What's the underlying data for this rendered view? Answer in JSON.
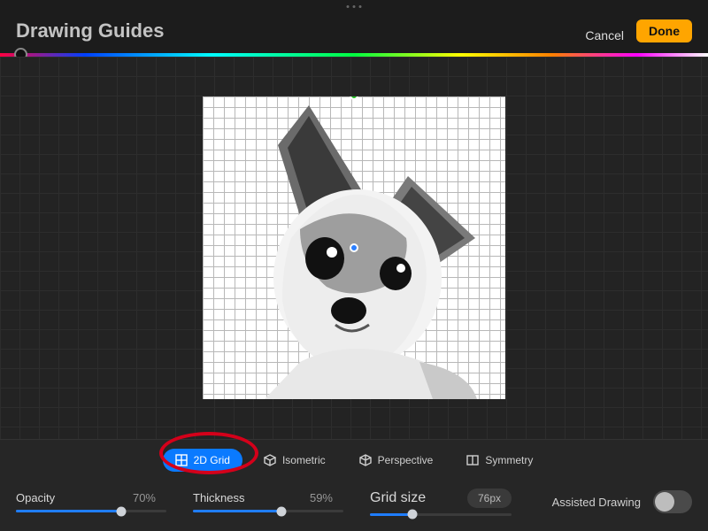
{
  "header": {
    "title": "Drawing Guides",
    "cancel": "Cancel",
    "done": "Done"
  },
  "tabs": [
    {
      "id": "grid-2d",
      "label": "2D Grid",
      "active": true
    },
    {
      "id": "isometric",
      "label": "Isometric",
      "active": false
    },
    {
      "id": "perspective",
      "label": "Perspective",
      "active": false
    },
    {
      "id": "symmetry",
      "label": "Symmetry",
      "active": false
    }
  ],
  "params": {
    "opacity": {
      "label": "Opacity",
      "value": "70%",
      "percent": 70
    },
    "thickness": {
      "label": "Thickness",
      "value": "59%",
      "percent": 59
    },
    "grid_size": {
      "label": "Grid size",
      "value": "76px"
    }
  },
  "assisted_drawing": {
    "label": "Assisted Drawing",
    "on": false
  },
  "colors": {
    "accent": "#0a7aff",
    "done": "#ffa500",
    "annotation": "#d4001a"
  }
}
